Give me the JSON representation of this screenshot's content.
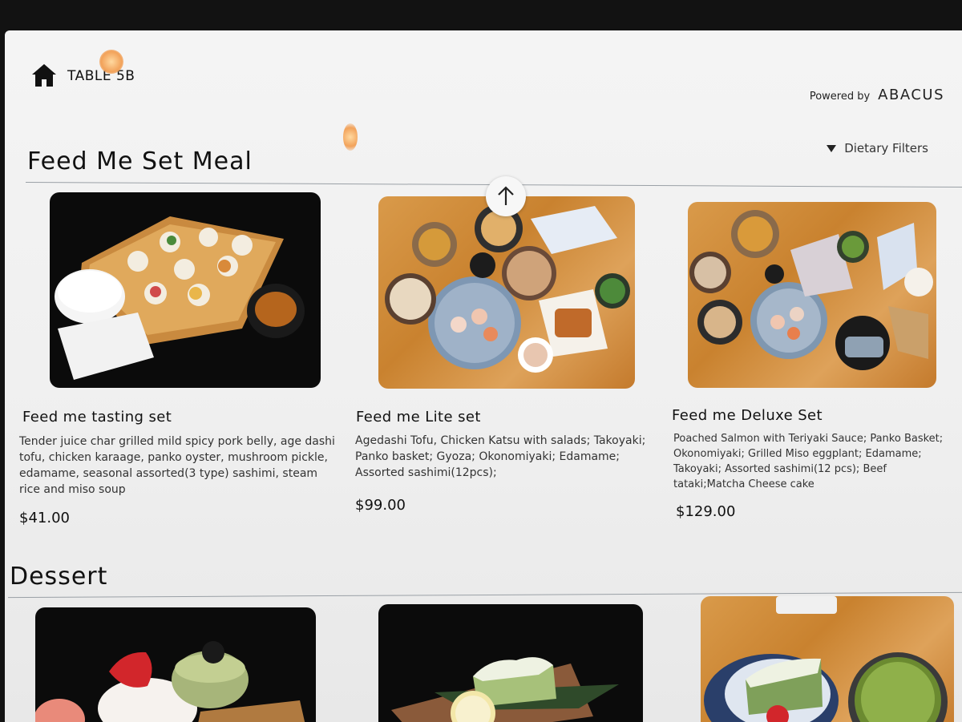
{
  "header": {
    "table_label": "TABLE 5B",
    "powered_by": "Powered by",
    "brand": "ABACUS"
  },
  "filter": {
    "label": "Dietary Filters"
  },
  "sections": [
    {
      "title": "Feed Me Set Meal",
      "items": [
        {
          "name": "Feed me tasting set",
          "description": "Tender juice char grilled mild spicy pork belly, age dashi tofu, chicken karaage, panko oyster, mushroom pickle, edamame, seasonal assorted(3 type) sashimi, steam rice and miso soup",
          "price": "$41.00"
        },
        {
          "name": "Feed me Lite set",
          "description": "Agedashi Tofu, Chicken Katsu with salads; Takoyaki; Panko basket; Gyoza; Okonomiyaki; Edamame; Assorted sashimi(12pcs);",
          "price": "$99.00"
        },
        {
          "name": "Feed me Deluxe Set",
          "description": "Poached Salmon with Teriyaki Sauce; Panko Basket; Okonomiyaki; Grilled Miso eggplant; Edamame; Takoyaki; Assorted sashimi(12 pcs); Beef tataki;Matcha Cheese cake",
          "price": "$129.00"
        }
      ]
    },
    {
      "title": "Dessert"
    }
  ],
  "colors": {
    "wood": "#d0893a",
    "dark_plate": "#0b0b0b",
    "background": "#f0f0f0"
  },
  "icons": {
    "home": "home-icon",
    "scroll": "arrow-up-icon",
    "filter": "triangle-down-icon"
  }
}
